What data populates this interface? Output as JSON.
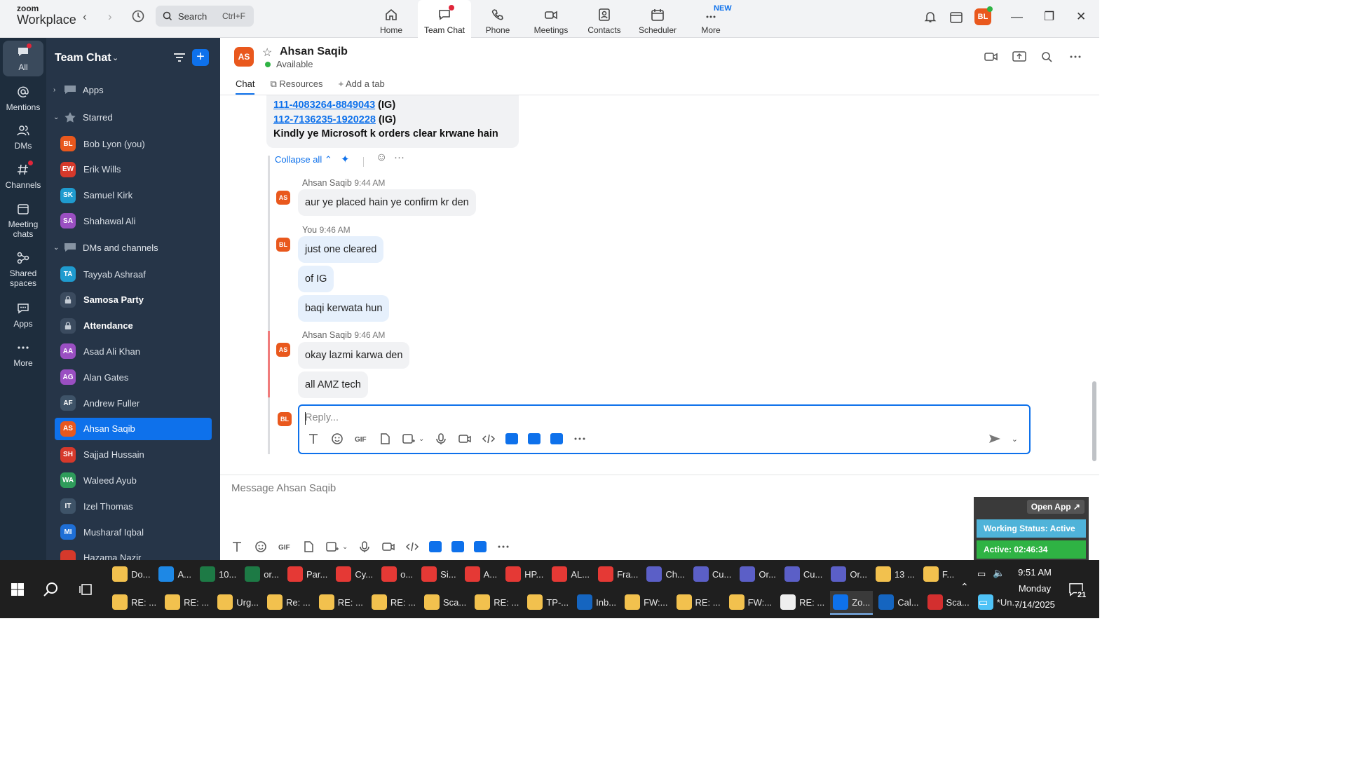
{
  "app": {
    "brand_top": "zoom",
    "brand_bottom": "Workplace"
  },
  "topbar": {
    "search_label": "Search",
    "search_shortcut": "Ctrl+F",
    "tabs": [
      {
        "label": "Home",
        "icon": "home-icon"
      },
      {
        "label": "Team Chat",
        "icon": "chat-icon",
        "active": true,
        "notification_dot": true
      },
      {
        "label": "Phone",
        "icon": "phone-icon"
      },
      {
        "label": "Meetings",
        "icon": "video-icon"
      },
      {
        "label": "Contacts",
        "icon": "contacts-icon"
      },
      {
        "label": "Scheduler",
        "icon": "calendar-icon"
      },
      {
        "label": "More",
        "icon": "more-icon",
        "badge": "NEW"
      }
    ],
    "user_initials": "BL"
  },
  "rail": [
    {
      "label": "All",
      "icon": "chat-bubble-icon"
    },
    {
      "label": "Mentions",
      "icon": "at-icon"
    },
    {
      "label": "DMs",
      "icon": "people-icon"
    },
    {
      "label": "Channels",
      "icon": "hash-icon"
    },
    {
      "label": "Meeting\nchats",
      "icon": "calendar-icon"
    },
    {
      "label": "Shared\nspaces",
      "icon": "share-icon"
    },
    {
      "label": "Apps",
      "icon": "apps-icon"
    },
    {
      "label": "More",
      "icon": "more-dots-icon"
    }
  ],
  "sidebar": {
    "title": "Team Chat",
    "sections": {
      "apps": "Apps",
      "starred": "Starred",
      "dms": "DMs and channels"
    },
    "starred": [
      {
        "initials": "BL",
        "name": "Bob Lyon (you)",
        "color": "#e9581d"
      },
      {
        "initials": "EW",
        "name": "Erik Wills",
        "color": "#d6392b"
      },
      {
        "initials": "SK",
        "name": "Samuel Kirk",
        "color": "#1f9bcf"
      },
      {
        "initials": "SA",
        "name": "Shahawal Ali",
        "color": "#9a4fc2"
      }
    ],
    "dms": [
      {
        "initials": "TA",
        "name": "Tayyab Ashraaf",
        "color": "#1f9bcf"
      },
      {
        "initials": "",
        "name": "Samosa Party",
        "lock": true,
        "bold": true
      },
      {
        "initials": "",
        "name": "Attendance",
        "lock": true,
        "bold": true
      },
      {
        "initials": "AA",
        "name": "Asad Ali Khan",
        "color": "#9a4fc2"
      },
      {
        "initials": "AG",
        "name": "Alan Gates",
        "color": "#9a4fc2"
      },
      {
        "initials": "AF",
        "name": "Andrew Fuller",
        "color": "#3e5368"
      },
      {
        "initials": "AS",
        "name": "Ahsan Saqib",
        "color": "#e9581d",
        "selected": true
      },
      {
        "initials": "SH",
        "name": "Sajjad Hussain",
        "color": "#d6392b"
      },
      {
        "initials": "WA",
        "name": "Waleed Ayub",
        "color": "#2f9c5b"
      },
      {
        "initials": "IT",
        "name": "Izel Thomas",
        "color": "#3e5368"
      },
      {
        "initials": "MI",
        "name": "Musharaf Iqbal",
        "color": "#1f6fd6"
      },
      {
        "initials": "",
        "name": "Hazama Nazir",
        "color": "#d6392b"
      }
    ]
  },
  "chat": {
    "contact_initials": "AS",
    "contact_name": "Ahsan Saqib",
    "status": "Available",
    "tabs": [
      "Chat",
      "Resources",
      "Add a tab"
    ],
    "quote_lines": [
      {
        "link": "111-4083264-8849043",
        "suffix": " (IG)"
      },
      {
        "link": "112-7136235-1920228",
        "suffix": " (IG)"
      },
      {
        "link": "",
        "suffix": "Kindly ye Microsoft k orders clear krwane hain"
      }
    ],
    "collapse_label": "Collapse all",
    "messages": [
      {
        "sender": "Ahsan Saqib",
        "time": "9:44 AM",
        "initials": "AS",
        "texts": [
          "aur ye placed hain ye confirm kr den"
        ]
      },
      {
        "sender": "You",
        "time": "9:46 AM",
        "initials": "BL",
        "texts": [
          "just one cleared",
          "of IG",
          "baqi kerwata hun"
        ]
      },
      {
        "sender": "Ahsan Saqib",
        "time": "9:46 AM",
        "initials": "AS",
        "texts": [
          "okay lazmi karwa den",
          "all AMZ tech"
        ]
      }
    ],
    "reply_placeholder": "Reply...",
    "reply_initials": "BL",
    "composer_placeholder": "Message Ahsan Saqib"
  },
  "widget": {
    "open_app": "Open App ↗",
    "working_status": "Working Status: Active",
    "active_timer": "Active: 02:46:34"
  },
  "taskbar": {
    "row1": [
      {
        "label": "Do...",
        "color": "#f2c14e"
      },
      {
        "label": "A...",
        "color": "#1e88e5"
      },
      {
        "label": "10...",
        "color": "#1d7a45"
      },
      {
        "label": "or...",
        "color": "#1d7a45"
      },
      {
        "label": "Par...",
        "color": "#e53935"
      },
      {
        "label": "Cy...",
        "color": "#e53935"
      },
      {
        "label": "o...",
        "color": "#e53935"
      },
      {
        "label": "Si...",
        "color": "#e53935"
      },
      {
        "label": "A...",
        "color": "#e53935"
      },
      {
        "label": "HP...",
        "color": "#e53935"
      },
      {
        "label": "AL...",
        "color": "#e53935"
      },
      {
        "label": "Fra...",
        "color": "#e53935"
      },
      {
        "label": "Ch...",
        "color": "#5b5fc7"
      },
      {
        "label": "Cu...",
        "color": "#5b5fc7"
      },
      {
        "label": "Or...",
        "color": "#5b5fc7"
      },
      {
        "label": "Cu...",
        "color": "#5b5fc7"
      },
      {
        "label": "Or...",
        "color": "#5b5fc7"
      },
      {
        "label": "13 ...",
        "color": "#f2c14e"
      },
      {
        "label": "F...",
        "color": "#f2c14e"
      }
    ],
    "row2": [
      {
        "label": "RE: ...",
        "color": "#f2c14e"
      },
      {
        "label": "RE: ...",
        "color": "#f2c14e"
      },
      {
        "label": "Urg...",
        "color": "#f2c14e"
      },
      {
        "label": "Re: ...",
        "color": "#f2c14e"
      },
      {
        "label": "RE: ...",
        "color": "#f2c14e"
      },
      {
        "label": "RE: ...",
        "color": "#f2c14e"
      },
      {
        "label": "Sca...",
        "color": "#f2c14e"
      },
      {
        "label": "RE: ...",
        "color": "#f2c14e"
      },
      {
        "label": "TP-...",
        "color": "#f2c14e"
      },
      {
        "label": "Inb...",
        "color": "#1565c0"
      },
      {
        "label": "FW:...",
        "color": "#f2c14e"
      },
      {
        "label": "RE: ...",
        "color": "#f2c14e"
      },
      {
        "label": "FW:...",
        "color": "#f2c14e"
      },
      {
        "label": "RE: ...",
        "color": "#eeeeee"
      },
      {
        "label": "Zo...",
        "color": "#0e71eb",
        "active": true
      },
      {
        "label": "Cal...",
        "color": "#1565c0"
      },
      {
        "label": "Sca...",
        "color": "#d32f2f"
      },
      {
        "label": "*Un...",
        "color": "#4fc3f7"
      }
    ],
    "time": "9:51 AM",
    "day": "Monday",
    "date": "7/14/2025",
    "notifications": "21"
  }
}
